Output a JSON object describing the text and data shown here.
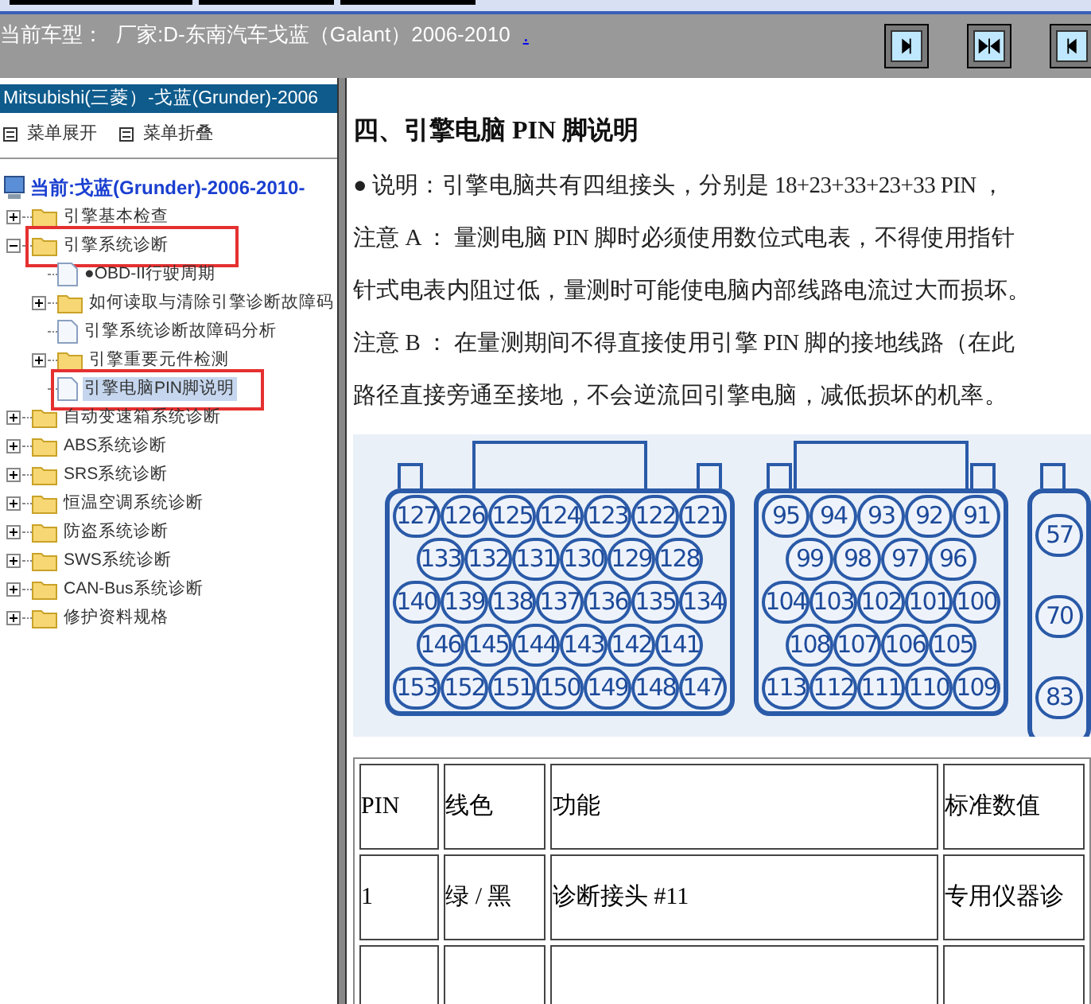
{
  "header": {
    "label": "当前车型：",
    "model": "厂家:D-东南汽车戈蓝（Galant）2006-2010",
    "link": "."
  },
  "header_buttons": [
    {
      "kind": "right"
    },
    {
      "kind": "both"
    },
    {
      "kind": "left"
    }
  ],
  "sidebar": {
    "title": "Mitsubishi(三菱）-戈蓝(Grunder)-2006",
    "menu": [
      "菜单展开",
      "菜单折叠"
    ],
    "tree": {
      "label": "当前:戈蓝(Grunder)-2006-2010-",
      "children": [
        {
          "kind": "folder",
          "label": "引擎基本检查",
          "expanded": false,
          "highlighted": false,
          "selected": false
        },
        {
          "kind": "folder",
          "label": "引擎系统诊断",
          "expanded": true,
          "highlighted": true,
          "selected": false,
          "children": [
            {
              "kind": "doc",
              "label": "●OBD-II行驶周期",
              "highlighted": false,
              "selected": false
            },
            {
              "kind": "folder",
              "label": "如何读取与清除引擎诊断故障码",
              "expanded": false,
              "highlighted": false,
              "selected": false
            },
            {
              "kind": "doc",
              "label": "引擎系统诊断故障码分析",
              "highlighted": false,
              "selected": false
            },
            {
              "kind": "folder",
              "label": "引擎重要元件检测",
              "expanded": false,
              "highlighted": false,
              "selected": false
            },
            {
              "kind": "doc",
              "label": "引擎电脑PIN脚说明",
              "highlighted": true,
              "selected": true
            }
          ]
        },
        {
          "kind": "folder",
          "label": "自动变速箱系统诊断",
          "expanded": false,
          "highlighted": false,
          "selected": false
        },
        {
          "kind": "folder",
          "label": "ABS系统诊断",
          "expanded": false,
          "highlighted": false,
          "selected": false
        },
        {
          "kind": "folder",
          "label": "SRS系统诊断",
          "expanded": false,
          "highlighted": false,
          "selected": false
        },
        {
          "kind": "folder",
          "label": "恒温空调系统诊断",
          "expanded": false,
          "highlighted": false,
          "selected": false
        },
        {
          "kind": "folder",
          "label": "防盗系统诊断",
          "expanded": false,
          "highlighted": false,
          "selected": false
        },
        {
          "kind": "folder",
          "label": "SWS系统诊断",
          "expanded": false,
          "highlighted": false,
          "selected": false
        },
        {
          "kind": "folder",
          "label": "CAN-Bus系统诊断",
          "expanded": false,
          "highlighted": false,
          "selected": false
        },
        {
          "kind": "folder",
          "label": "修护资料规格",
          "expanded": false,
          "highlighted": false,
          "selected": false
        }
      ]
    }
  },
  "content": {
    "heading": "四、引擎电脑 PIN 脚说明",
    "paragraphs": [
      "● 说明：引擎电脑共有四组接头，分别是 18+23+33+23+33 PIN ，",
      "注意 A ： 量测电脑 PIN 脚时必须使用数位式电表，不得使用指针",
      "针式电表内阻过低，量测时可能使电脑内部线路电流过大而损坏。",
      "注意 B ： 在量测期间不得直接使用引擎 PIN 脚的接地线路（在此",
      "路径直接旁通至接地，不会逆流回引擎电脑，减低损坏的机率。"
    ],
    "connectors": [
      {
        "rows": [
          [
            "127",
            "126",
            "125",
            "124",
            "123",
            "122",
            "121"
          ],
          [
            "133",
            "132",
            "131",
            "130",
            "129",
            "128"
          ],
          [
            "140",
            "139",
            "138",
            "137",
            "136",
            "135",
            "134"
          ],
          [
            "146",
            "145",
            "144",
            "143",
            "142",
            "141"
          ],
          [
            "153",
            "152",
            "151",
            "150",
            "149",
            "148",
            "147"
          ]
        ]
      },
      {
        "rows": [
          [
            "95",
            "94",
            "93",
            "92",
            "91"
          ],
          [
            "99",
            "98",
            "97",
            "96"
          ],
          [
            "104",
            "103",
            "102",
            "101",
            "100"
          ],
          [
            "108",
            "107",
            "106",
            "105"
          ],
          [
            "113",
            "112",
            "111",
            "110",
            "109"
          ]
        ]
      },
      {
        "rows": [
          [
            "57"
          ],
          [
            "70"
          ],
          [
            "83"
          ]
        ]
      }
    ],
    "table": {
      "columns": [
        "PIN",
        "线色",
        "功能",
        "标准数值"
      ],
      "rows": [
        [
          "1",
          "绿 / 黑",
          "诊断接头 #11",
          "专用仪器诊"
        ]
      ]
    }
  }
}
